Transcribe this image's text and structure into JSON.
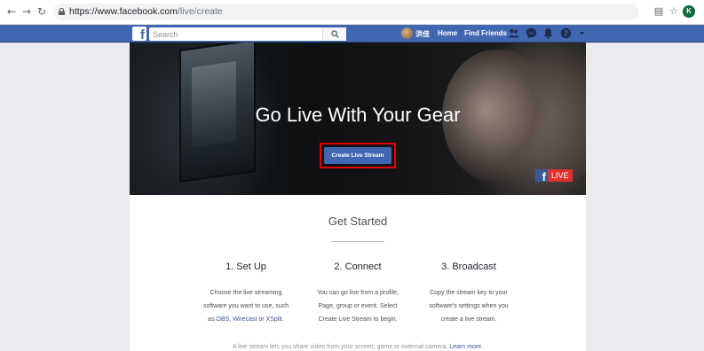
{
  "browser": {
    "url_host": "https://www.facebook.com",
    "url_path": "/live/create",
    "profile_initial": "K"
  },
  "topbar": {
    "search_placeholder": "Search",
    "user_name": "洪佳",
    "home_label": "Home",
    "find_friends_label": "Find Friends"
  },
  "hero": {
    "title": "Go Live With Your Gear",
    "cta_label": "Create Live Stream",
    "live_badge": "LIVE"
  },
  "get_started": {
    "title": "Get Started",
    "steps": [
      {
        "title": "1. Set Up",
        "line1": "Choose the live streaming",
        "line2": "software you want to use, such",
        "prefix": "as ",
        "link1": "OBS",
        "sep1": ", ",
        "link2": "Wirecast",
        "sep2": " or ",
        "link3": "XSplit",
        "suffix": "."
      },
      {
        "title": "2. Connect",
        "line1": "You can go live from a profile,",
        "line2": "Page, group or event. Select",
        "line3": "Create Live Stream to begin."
      },
      {
        "title": "3. Broadcast",
        "line1": "Copy the stream key to your",
        "line2": "software's settings when you",
        "line3": "create a live stream."
      }
    ],
    "footnote": "A live stream lets you share video from your screen, game or external camera. ",
    "learn_more": "Learn more."
  },
  "colors": {
    "fb_blue": "#4267b2",
    "highlight_red": "#e00000",
    "live_red": "#e0312f"
  },
  "icons": [
    "back-arrow-icon",
    "forward-arrow-icon",
    "reload-icon",
    "lock-icon",
    "translate-icon",
    "star-icon",
    "search-icon",
    "friend-requests-icon",
    "messenger-icon",
    "notifications-icon",
    "help-icon",
    "account-menu-caret-icon"
  ]
}
